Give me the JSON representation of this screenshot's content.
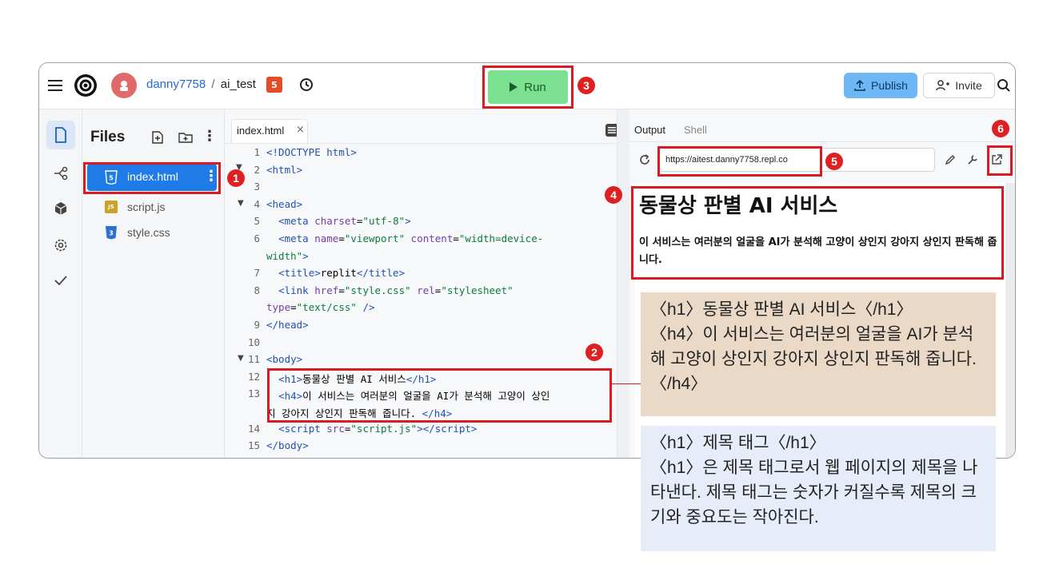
{
  "header": {
    "username": "danny7758",
    "separator": "/",
    "project": "ai_test",
    "run_label": "Run",
    "publish_label": "Publish",
    "invite_label": "Invite"
  },
  "files": {
    "title": "Files",
    "items": [
      {
        "name": "index.html",
        "icon": "html5-icon"
      },
      {
        "name": "script.js",
        "icon": "js-icon"
      },
      {
        "name": "style.css",
        "icon": "css3-icon"
      }
    ]
  },
  "editor": {
    "tab_name": "index.html",
    "lines": [
      {
        "n": "1",
        "html": "<span class='tag'>&lt;!DOCTYPE html&gt;</span>"
      },
      {
        "n": "2",
        "html": "<span class='tag'>&lt;html&gt;</span>"
      },
      {
        "n": "3",
        "html": ""
      },
      {
        "n": "4",
        "html": "<span class='tag'>&lt;head&gt;</span>"
      },
      {
        "n": "5",
        "html": "  <span class='tag'>&lt;meta</span> <span class='attr'>charset</span>=<span class='str'>\"utf-8\"</span><span class='tag'>&gt;</span>"
      },
      {
        "n": "6",
        "html": "  <span class='tag'>&lt;meta</span> <span class='attr'>name</span>=<span class='str'>\"viewport\"</span> <span class='attr'>content</span>=<span class='str'>\"width=device-</span>"
      },
      {
        "n": "",
        "html": "<span class='str'>width\"</span><span class='tag'>&gt;</span>"
      },
      {
        "n": "7",
        "html": "  <span class='tag'>&lt;title&gt;</span>replit<span class='tag'>&lt;/title&gt;</span>"
      },
      {
        "n": "8",
        "html": "  <span class='tag'>&lt;link</span> <span class='attr'>href</span>=<span class='str'>\"style.css\"</span> <span class='attr'>rel</span>=<span class='str'>\"stylesheet\"</span>"
      },
      {
        "n": "",
        "html": "<span class='attr'>type</span>=<span class='str'>\"text/css\"</span> <span class='tag'>/&gt;</span>"
      },
      {
        "n": "9",
        "html": "<span class='tag'>&lt;/head&gt;</span>"
      },
      {
        "n": "10",
        "html": ""
      },
      {
        "n": "11",
        "html": "<span class='tag'>&lt;body&gt;</span>"
      },
      {
        "n": "12",
        "html": "  <span class='tag'>&lt;h1&gt;</span>동물상 판별 AI 서비스<span class='tag'>&lt;/h1&gt;</span>"
      },
      {
        "n": "13",
        "html": "  <span class='tag'>&lt;h4&gt;</span>이 서비스는 여러분의 얼굴을 AI가 분석해 고양이 상인"
      },
      {
        "n": "",
        "html": "지 강아지 상인지 판독해 줍니다. <span class='tag'>&lt;/h4&gt;</span>"
      },
      {
        "n": "14",
        "html": "  <span class='tag'>&lt;script</span> <span class='attr'>src</span>=<span class='str'>\"script.js\"</span><span class='tag'>&gt;&lt;/script&gt;</span>"
      },
      {
        "n": "15",
        "html": "<span class='tag'>&lt;/body&gt;</span>"
      }
    ]
  },
  "output": {
    "tab_output": "Output",
    "tab_shell": "Shell",
    "url": "https://aitest.danny7758.repl.co",
    "page_h1": "동물상 판별 AI 서비스",
    "page_h4": "이 서비스는 여러분의 얼굴을 AI가 분석해 고양이 상인지 강아지 상인지 판독해 줍니다."
  },
  "callouts": {
    "code_note": "〈h1〉동물상 판별 AI 서비스〈/h1〉\n〈h4〉이 서비스는 여러분의 얼굴을 AI가 분석해 고양이 상인지 강아지 상인지 판독해 줍니다. 〈/h4〉",
    "tag_note": "〈h1〉제목 태그〈/h1〉\n〈h1〉은 제목 태그로서 웹 페이지의 제목을 나타낸다. 제목 태그는 숫자가 커질수록 제목의 크기와 중요도는 작아진다."
  },
  "markers": [
    "1",
    "2",
    "3",
    "4",
    "5",
    "6"
  ],
  "colors": {
    "run_bg": "#7be08f",
    "publish_bg": "#6fb6f5",
    "selected_file_bg": "#1e7be8",
    "callout1_bg": "#ead9c6",
    "callout2_bg": "#e6ecf8",
    "marker_red": "#d91c24"
  }
}
